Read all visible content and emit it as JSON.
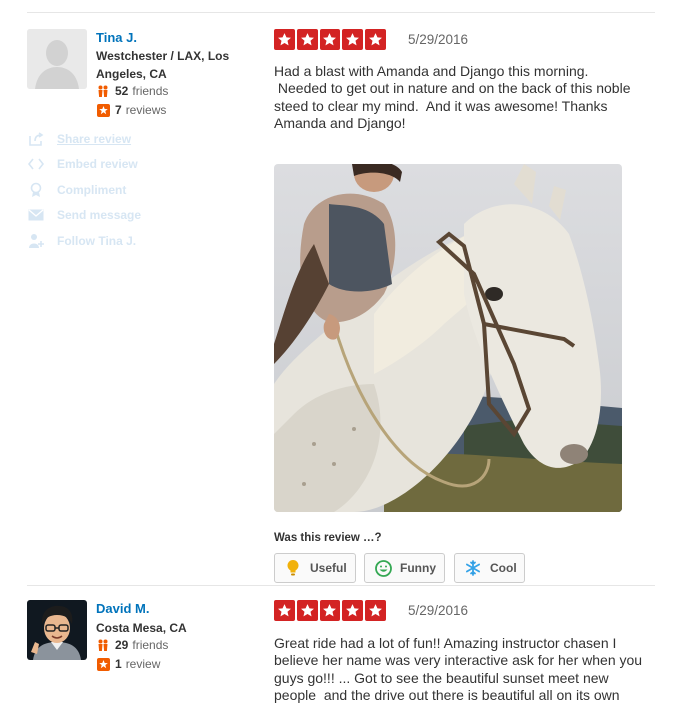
{
  "reviews": [
    {
      "user": {
        "name": "Tina J.",
        "location": "Westchester / LAX, Los Angeles, CA",
        "friends_count": "52",
        "friends_label": "friends",
        "reviews_count": "7",
        "reviews_label": "reviews"
      },
      "actions": [
        "Share review",
        "Embed review",
        "Compliment",
        "Send message",
        "Follow Tina J."
      ],
      "rating": 5,
      "date": "5/29/2016",
      "text": "Had a blast with Amanda and Django this morning.\n Needed to get out in nature and on the back of this noble steed to clear my mind.  And it was awesome! Thanks Amanda and Django!",
      "vote_prompt": "Was this review …?",
      "votes": {
        "useful": "Useful",
        "funny": "Funny",
        "cool": "Cool"
      }
    },
    {
      "user": {
        "name": "David M.",
        "location": "Costa Mesa, CA",
        "friends_count": "29",
        "friends_label": "friends",
        "reviews_count": "1",
        "reviews_label": "review"
      },
      "rating": 5,
      "date": "5/29/2016",
      "text": "Great ride had a lot of fun!! Amazing instructor chasen I believe her name was very interactive ask for her when you guys go!!! ... Got to see the beautiful sunset meet new people  and the drive out there is beautiful all on its own"
    }
  ],
  "colors": {
    "star_red": "#d32323",
    "link_blue": "#0073bb",
    "faded_action": "#d7e6f3"
  },
  "icons": {
    "friends": "friends-icon",
    "reviews": "review-star-icon",
    "share": "share-icon",
    "embed": "embed-code-icon",
    "compliment": "compliment-award-icon",
    "message": "envelope-icon",
    "follow": "follow-user-icon",
    "useful": "lightbulb-icon",
    "funny": "smiley-icon",
    "cool": "snowflake-icon"
  }
}
